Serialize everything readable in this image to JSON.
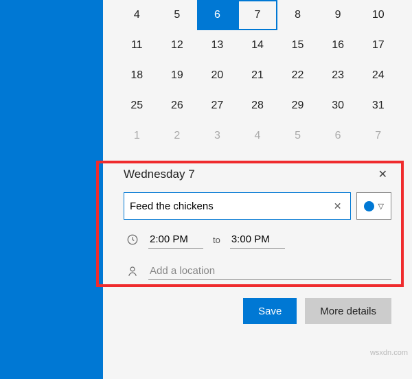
{
  "calendar": {
    "weeks": [
      [
        "4",
        "5",
        "6",
        "7",
        "8",
        "9",
        "10"
      ],
      [
        "11",
        "12",
        "13",
        "14",
        "15",
        "16",
        "17"
      ],
      [
        "18",
        "19",
        "20",
        "21",
        "22",
        "23",
        "24"
      ],
      [
        "25",
        "26",
        "27",
        "28",
        "29",
        "30",
        "31"
      ],
      [
        "1",
        "2",
        "3",
        "4",
        "5",
        "6",
        "7"
      ]
    ],
    "today": "6",
    "selected": "7"
  },
  "event": {
    "date_label": "Wednesday 7",
    "title_value": "Feed the chickens",
    "start_time": "2:00 PM",
    "to_label": "to",
    "end_time": "3:00 PM",
    "location_placeholder": "Add a location",
    "save_label": "Save",
    "more_label": "More details"
  },
  "colors": {
    "accent": "#0078d4",
    "annotation": "#ef2b2d"
  },
  "watermark": "wsxdn.com"
}
